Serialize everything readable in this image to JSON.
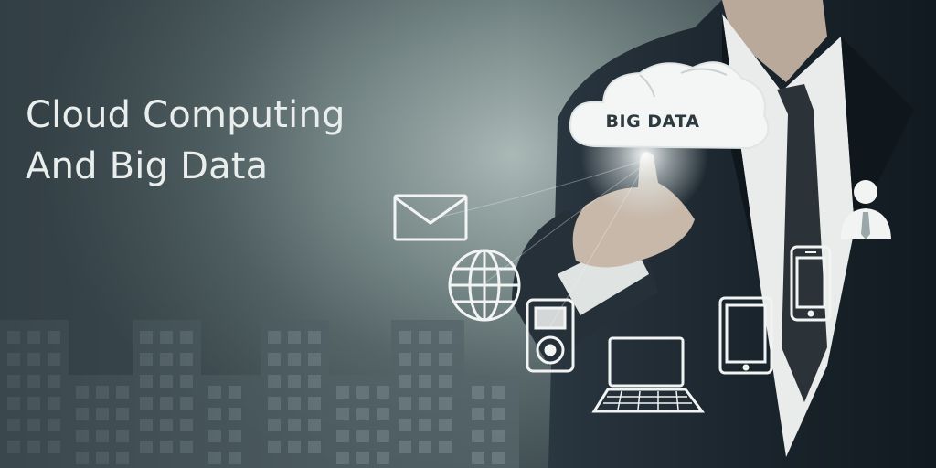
{
  "heading": {
    "line1": "Cloud Computing",
    "line2": "And Big Data"
  },
  "cloud": {
    "label": "BIG DATA"
  },
  "icons": [
    "envelope-icon",
    "globe-icon",
    "media-player-icon",
    "laptop-icon",
    "tablet-icon",
    "smartphone-icon",
    "user-icon"
  ],
  "colors": {
    "background": "#6f8180",
    "text": "#e9eeed",
    "suit": "#1f2a33",
    "icon": "#f2f4f3"
  }
}
